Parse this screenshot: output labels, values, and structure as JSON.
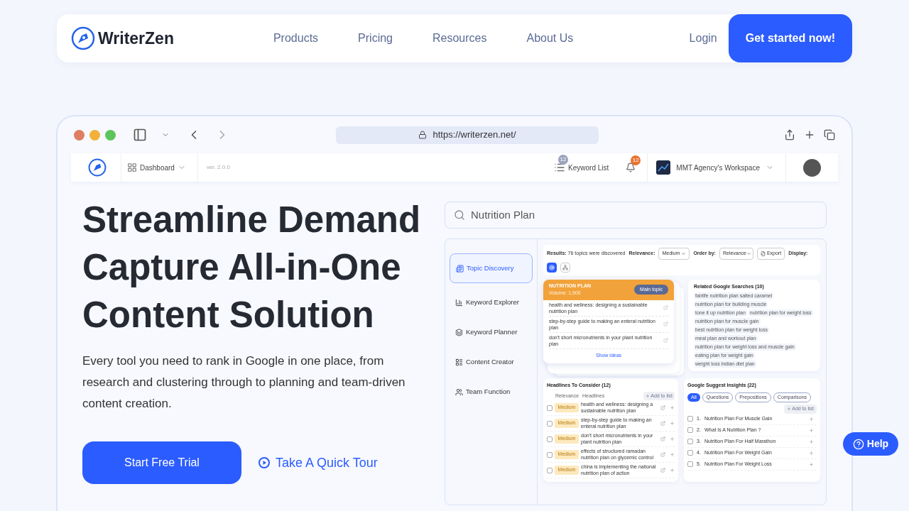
{
  "nav": {
    "logo": "WriterZen",
    "links": [
      "Products",
      "Pricing",
      "Resources",
      "About Us"
    ],
    "login": "Login",
    "cta": "Get started now!"
  },
  "browser": {
    "url": "https://writerzen.net/"
  },
  "app_header": {
    "dashboard": "Dashboard",
    "version": "ver. 2.0.0",
    "keyword_list": "Keyword List",
    "keyword_badge": "12",
    "notification_badge": "12",
    "workspace": "MMT Agency's Workspace"
  },
  "hero": {
    "title": [
      "Streamline Demand",
      "Capture All-in-One",
      "Content Solution"
    ],
    "description": "Every tool you need to rank in Google in one place, from research and clustering through to planning and team-driven content creation.",
    "primary_button": "Start Free Trial",
    "tour_link": "Take A Quick Tour"
  },
  "search": {
    "value": "Nutrition Plan"
  },
  "sidebar": [
    {
      "label": "Topic Discovery",
      "selected": true
    },
    {
      "label": "Keyword Explorer",
      "selected": false
    },
    {
      "label": "Keyword Planner",
      "selected": false
    },
    {
      "label": "Content Creator",
      "selected": false
    },
    {
      "label": "Team Function",
      "selected": false
    }
  ],
  "filter_bar": {
    "results_label": "Results:",
    "results_text": "76 topics were discovered",
    "relevance_label": "Relevance:",
    "relevance_value": "Medium",
    "order_label": "Order by:",
    "order_value": "Relevance",
    "export": "Export",
    "display_label": "Display:",
    "display_options": [
      {
        "selected": true
      },
      {
        "selected": false
      }
    ]
  },
  "topic_card": {
    "title": "NUTRITION PLAN",
    "volume": "Volume: 1,900",
    "badge": "Main topic",
    "ideas": [
      "health and wellness: designing a sustainable nutrition plan",
      "step-by-step guide to making an enteral nutrition plan",
      "don't short micronutrients in your plant nutrition plan"
    ],
    "show_ideas": "Show ideas"
  },
  "related": {
    "title": "Related Google Searches (10)",
    "tags": [
      "fairlife nutrition plan salted caramel",
      "nutrition plan for building muscle",
      "tone it up nutrition plan",
      "nutrition plan for weight loss",
      "nutrition plan for muscle gain",
      "best nutrition plan for weight loss",
      "meal plan and workout plan",
      "nutrition plan for weight loss and muscle gain",
      "eating plan for weight gain",
      "weight loss indian diet plan"
    ]
  },
  "headlines": {
    "title": "Headlines To Consider (12)",
    "columns": [
      "Relevance",
      "Headlines"
    ],
    "add_button": "Add to list",
    "rows": [
      {
        "relevance": "Medium",
        "text": "health and wellness: designing a sustainable nutrition plan",
        "checked": false
      },
      {
        "relevance": "Medium",
        "text": "step-by-step guide to making an enteral nutrition plan",
        "checked": false
      },
      {
        "relevance": "Medium",
        "text": "don't short micronutrients in your plant nutrition plan",
        "checked": false
      },
      {
        "relevance": "Medium",
        "text": "effects of structured ramadan nutrition plan on glycemic control",
        "checked": false
      },
      {
        "relevance": "Medium",
        "text": "china is implementing the national nutrition plan of action",
        "checked": false
      }
    ]
  },
  "suggest": {
    "title": "Google Suggest Insights (22)",
    "filters": [
      {
        "label": "All",
        "selected": true
      },
      {
        "label": "Questions",
        "selected": false
      },
      {
        "label": "Prepositions",
        "selected": false
      },
      {
        "label": "Comparisons",
        "selected": false
      }
    ],
    "add_button": "Add to list",
    "items": [
      {
        "number": "1.",
        "text": "Nutrition Plan For Muscle Gain",
        "checked": false
      },
      {
        "number": "2.",
        "text": "What Is A Nutrition Plan ?",
        "checked": false
      },
      {
        "number": "3.",
        "text": "Nutrition Plan For Half Marathon",
        "checked": false
      },
      {
        "number": "4.",
        "text": "Nutrition Plan For Weight Gain",
        "checked": false
      },
      {
        "number": "5.",
        "text": "Nutrition Plan For Weight Loss",
        "checked": false
      }
    ]
  },
  "help": "Help"
}
